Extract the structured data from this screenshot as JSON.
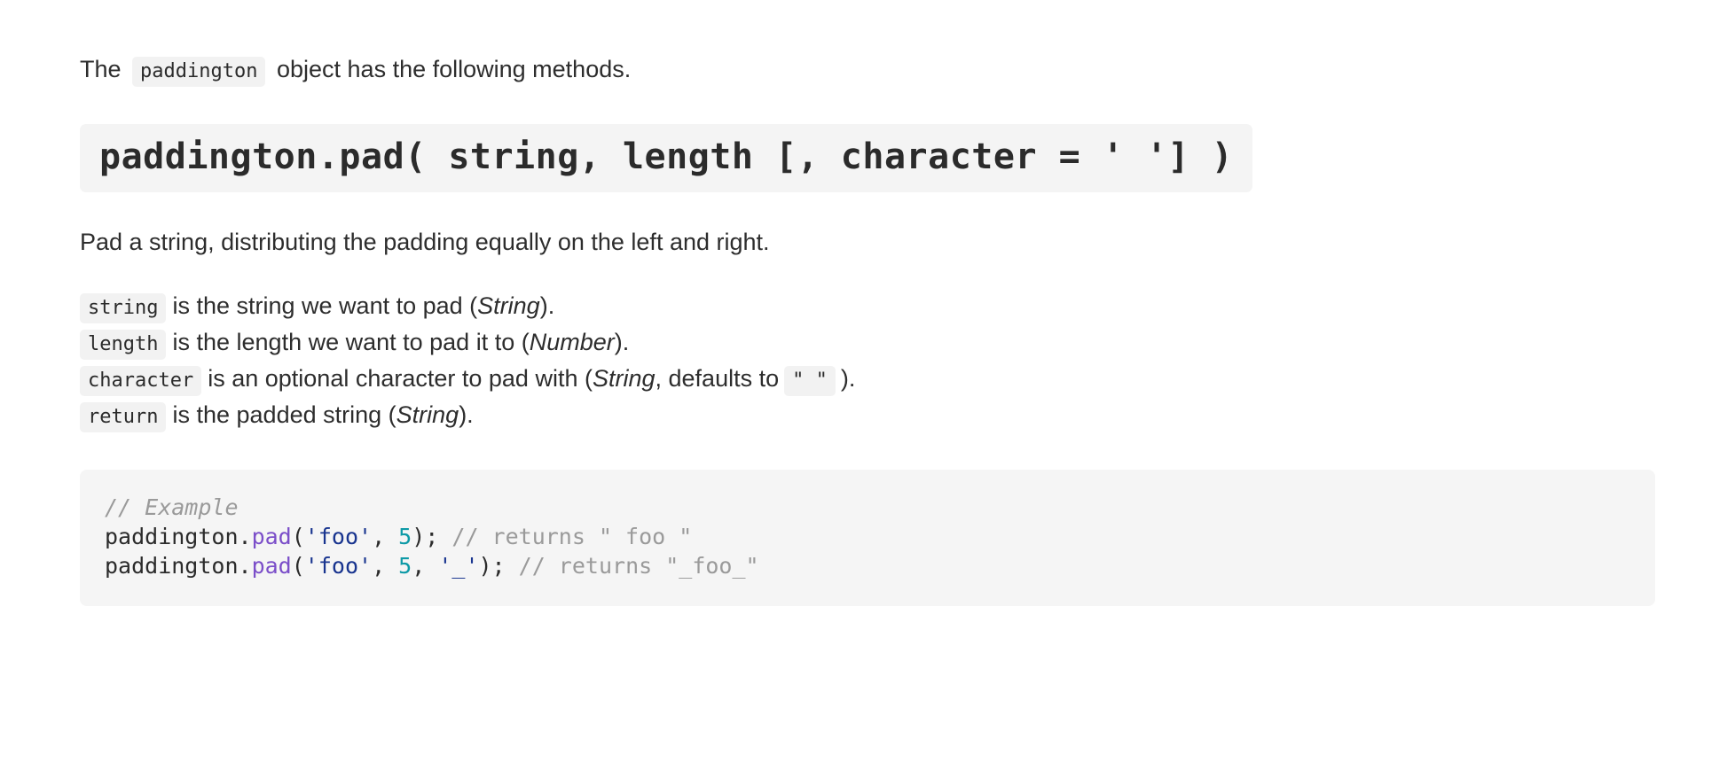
{
  "intro": {
    "before": "The",
    "code": "paddington",
    "after": "object has the following methods."
  },
  "signature": {
    "text": "paddington.pad( string, length [, character = ' '] )"
  },
  "description": {
    "text": "Pad a string, distributing the padding equally on the left and right."
  },
  "params": [
    {
      "name": "string",
      "before": "is the string we want to pad (",
      "type": "String",
      "after": ")."
    },
    {
      "name": "length",
      "before": "is the length we want to pad it to (",
      "type": "Number",
      "after": ")."
    },
    {
      "name": "character",
      "before": "is an optional character to pad with (",
      "type": "String",
      "mid": ", defaults to",
      "default_code": "\" \"",
      "after": ")."
    },
    {
      "name": "return",
      "before": "is the padded string (",
      "type": "String",
      "after": ")."
    }
  ],
  "code_block": {
    "lines": [
      {
        "tokens": [
          {
            "kind": "comment",
            "text": "// Example"
          }
        ]
      },
      {
        "tokens": [
          {
            "kind": "plain",
            "text": "paddington."
          },
          {
            "kind": "fn",
            "text": "pad"
          },
          {
            "kind": "plain",
            "text": "("
          },
          {
            "kind": "str",
            "text": "'foo'"
          },
          {
            "kind": "plain",
            "text": ", "
          },
          {
            "kind": "num",
            "text": "5"
          },
          {
            "kind": "plain",
            "text": "); "
          },
          {
            "kind": "comment-plain",
            "text": "// returns \" foo \""
          }
        ]
      },
      {
        "tokens": [
          {
            "kind": "plain",
            "text": "paddington."
          },
          {
            "kind": "fn",
            "text": "pad"
          },
          {
            "kind": "plain",
            "text": "("
          },
          {
            "kind": "str",
            "text": "'foo'"
          },
          {
            "kind": "plain",
            "text": ", "
          },
          {
            "kind": "num",
            "text": "5"
          },
          {
            "kind": "plain",
            "text": ", "
          },
          {
            "kind": "str",
            "text": "'_'"
          },
          {
            "kind": "plain",
            "text": "); "
          },
          {
            "kind": "comment-plain",
            "text": "// returns \"_foo_\""
          }
        ]
      }
    ]
  },
  "colors": {
    "page_background": "#ffffff",
    "chip_background": "#f2f2f2",
    "signature_background": "#f4f4f4",
    "code_background": "#f5f5f5",
    "text": "#2b2b2b",
    "comment": "#9a9a9a",
    "function": "#7b4ec9",
    "string": "#18348f",
    "number": "#0e9aa7"
  }
}
